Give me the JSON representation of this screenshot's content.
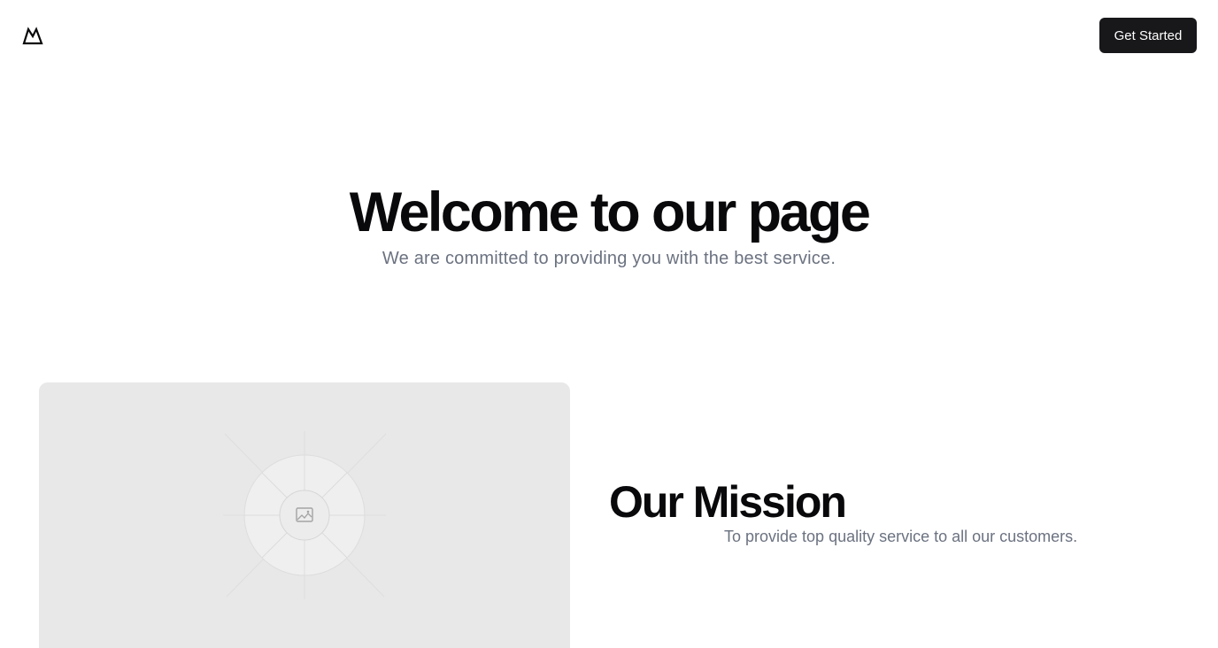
{
  "header": {
    "logo_icon": "mountain-logo-icon",
    "cta_label": "Get Started"
  },
  "hero": {
    "title": "Welcome to our page",
    "subtitle": "We are committed to providing you with the best service."
  },
  "feature": {
    "image_icon": "image-placeholder-icon",
    "title": "Our Mission",
    "text": "To provide top quality service to all our customers."
  },
  "colors": {
    "button_bg": "#18181b",
    "button_text": "#ffffff",
    "heading": "#09090b",
    "muted_text": "#6b7280",
    "placeholder_bg": "#e8e8e8"
  }
}
